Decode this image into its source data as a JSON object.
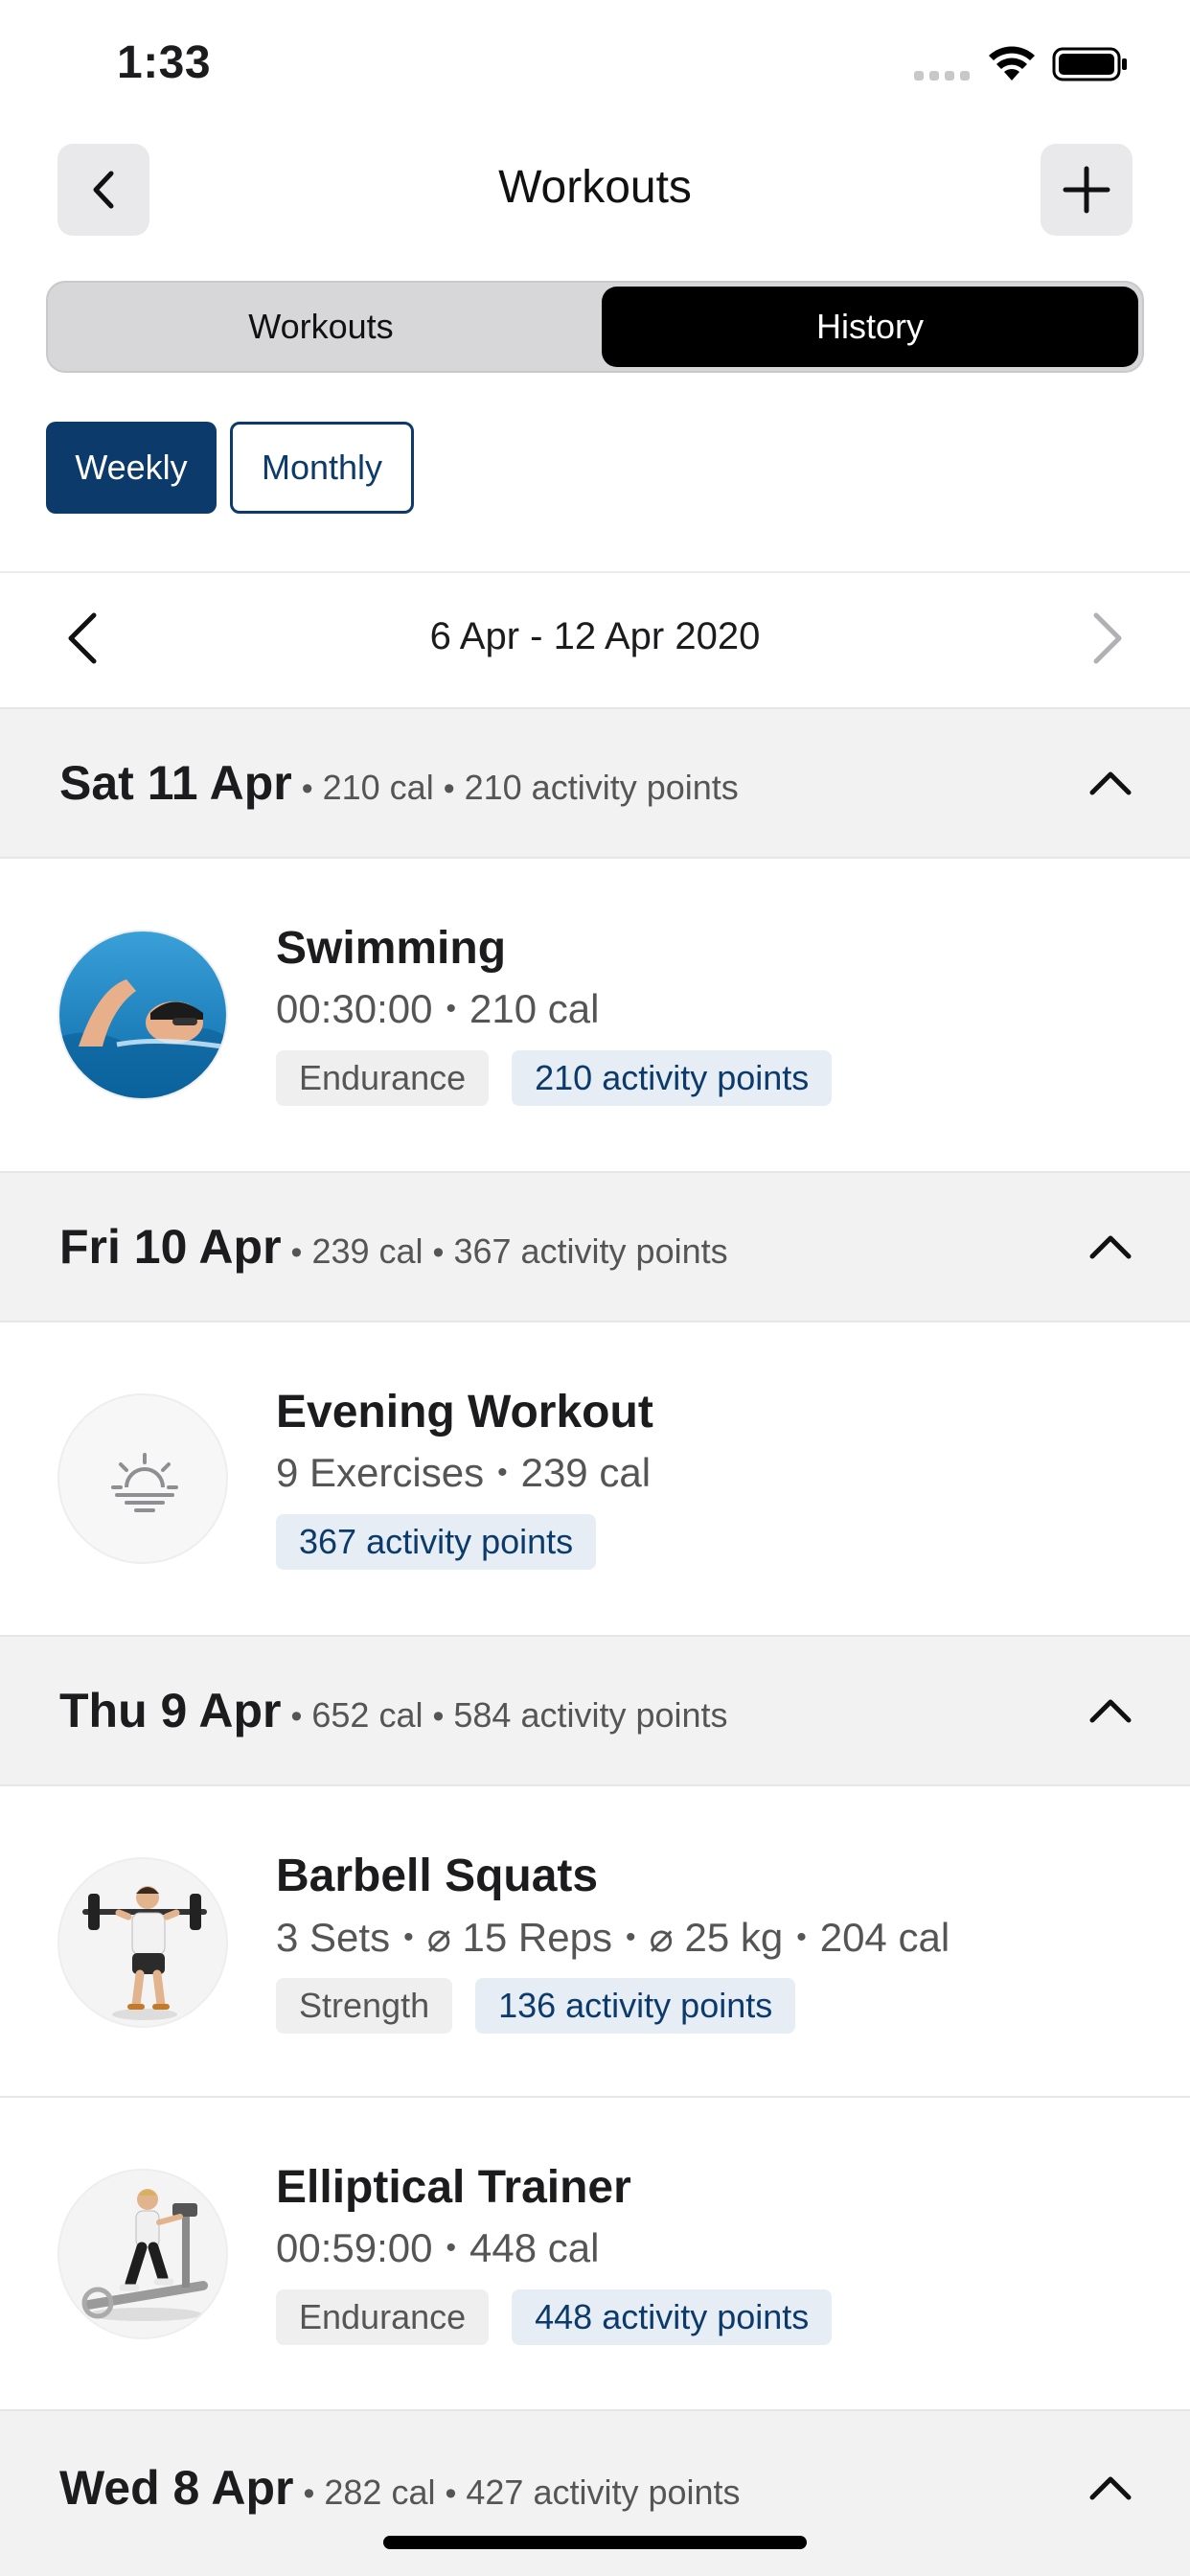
{
  "status_bar": {
    "time": "1:33"
  },
  "header": {
    "title": "Workouts"
  },
  "segments": {
    "workouts": "Workouts",
    "history": "History",
    "selected": "History"
  },
  "period": {
    "weekly": "Weekly",
    "monthly": "Monthly",
    "selected": "Weekly"
  },
  "range": {
    "label": "6 Apr - 12 Apr 2020"
  },
  "days": [
    {
      "title": "Sat 11 Apr",
      "calories": "210 cal",
      "points": "210 activity points",
      "workouts": [
        {
          "name": "Swimming",
          "detail_1": "00:30:00",
          "detail_2": "210 cal",
          "tag_category": "Endurance",
          "tag_points": "210 activity points",
          "image": "swimmer-photo"
        }
      ]
    },
    {
      "title": "Fri 10 Apr",
      "calories": "239 cal",
      "points": "367 activity points",
      "workouts": [
        {
          "name": "Evening Workout",
          "detail_1": "9 Exercises",
          "detail_2": "239 cal",
          "tag_points": "367 activity points",
          "image": "sunset-icon"
        }
      ]
    },
    {
      "title": "Thu 9 Apr",
      "calories": "652 cal",
      "points": "584 activity points",
      "workouts": [
        {
          "name": "Barbell Squats",
          "detail_1": "3 Sets",
          "detail_2": "⌀ 15 Reps",
          "detail_3": "⌀ 25 kg",
          "detail_4": "204 cal",
          "tag_category": "Strength",
          "tag_points": "136 activity points",
          "image": "barbell-squat-figure"
        },
        {
          "name": "Elliptical Trainer",
          "detail_1": "00:59:00",
          "detail_2": "448 cal",
          "tag_category": "Endurance",
          "tag_points": "448 activity points",
          "image": "elliptical-figure"
        }
      ]
    },
    {
      "title": "Wed 8 Apr",
      "calories": "282 cal",
      "points": "427 activity points",
      "workouts": []
    }
  ],
  "colors": {
    "brand": "#0b3a6b",
    "tag_blue_bg": "#e6edf4",
    "section_bg": "#f2f2f3"
  }
}
